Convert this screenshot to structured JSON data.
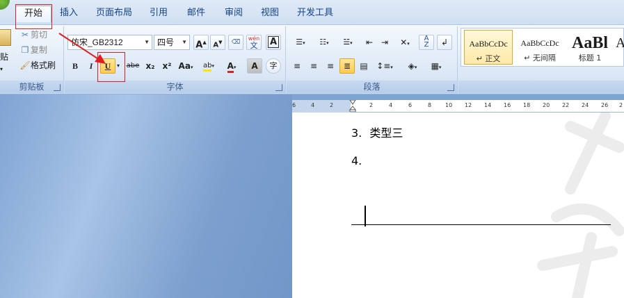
{
  "tabs": [
    {
      "label": "开始",
      "active": true
    },
    {
      "label": "插入"
    },
    {
      "label": "页面布局"
    },
    {
      "label": "引用"
    },
    {
      "label": "邮件"
    },
    {
      "label": "审阅"
    },
    {
      "label": "视图"
    },
    {
      "label": "开发工具"
    }
  ],
  "clipboard": {
    "cut_label": "剪切",
    "copy_label": "复制",
    "paste_label": "贴",
    "format_painter_label": "格式刷",
    "group_label": "剪贴板"
  },
  "font": {
    "name_value": "仿宋_GB2312",
    "size_value": "四号",
    "grow_label": "A",
    "shrink_label": "A",
    "pinyin_label": "wén",
    "bold_label": "B",
    "italic_label": "I",
    "underline_label": "U",
    "strike_label": "abe",
    "subscript_label": "x₂",
    "superscript_label": "x²",
    "case_label": "Aa",
    "highlight_label": "ab",
    "color_label": "A",
    "shade_label": "A",
    "enclose_label": "字",
    "group_label": "字体"
  },
  "paragraph": {
    "group_label": "段落"
  },
  "styles": [
    {
      "sample": "AaBbCcDc",
      "name": "↵ 正文",
      "selected": true
    },
    {
      "sample": "AaBbCcDc",
      "name": "↵ 无间隔"
    },
    {
      "sample": "AaBl",
      "name": "标题 1"
    },
    {
      "sample": "A",
      "name": ""
    }
  ],
  "ruler_ticks": [
    "6",
    "4",
    "2",
    "2",
    "2",
    "4",
    "6",
    "8",
    "10",
    "12",
    "14",
    "16",
    "18",
    "20",
    "22",
    "24",
    "26",
    "2"
  ],
  "document": {
    "items": [
      {
        "number": "3.",
        "text": "类型三"
      },
      {
        "number": "4.",
        "text": ""
      }
    ]
  },
  "colors": {
    "annotation": "#e02020",
    "accent": "#15428b"
  }
}
